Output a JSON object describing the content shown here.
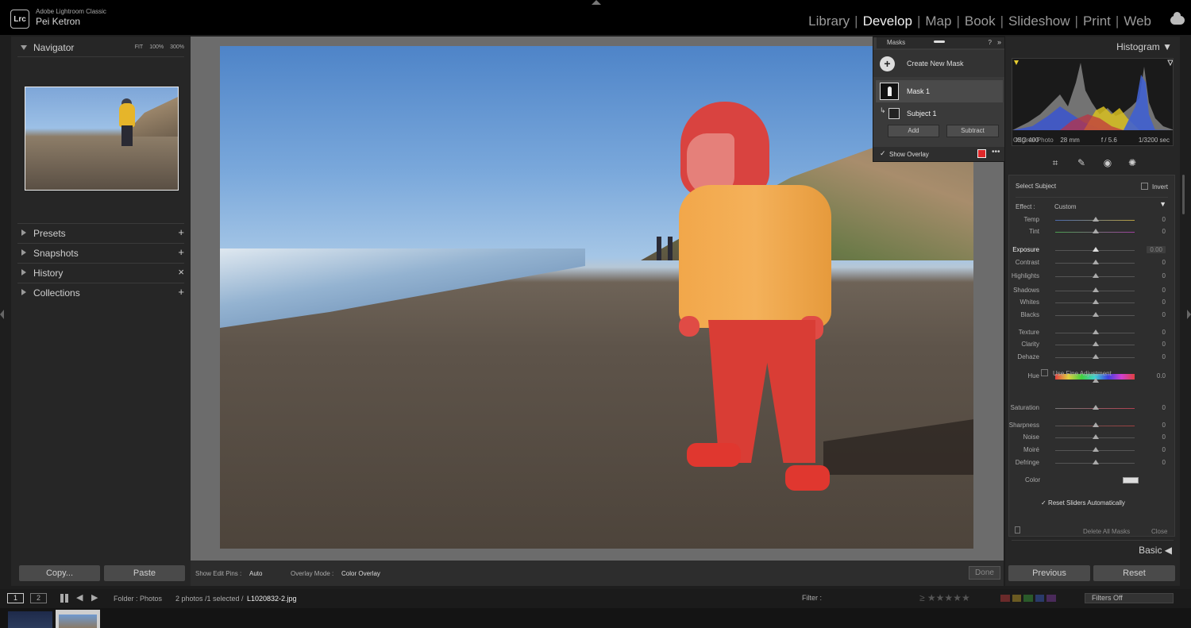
{
  "app": {
    "logo": "Lrc",
    "name": "Adobe Lightroom Classic",
    "user": "Pei Ketron"
  },
  "modules": [
    "Library",
    "Develop",
    "Map",
    "Book",
    "Slideshow",
    "Print",
    "Web"
  ],
  "active_module": "Develop",
  "left_panel": {
    "navigator": {
      "title": "Navigator",
      "zoom_options": [
        "FIT",
        "100%",
        "300%"
      ]
    },
    "sections": [
      {
        "label": "Presets",
        "action": "+"
      },
      {
        "label": "Snapshots",
        "action": "+"
      },
      {
        "label": "History",
        "action": "×"
      },
      {
        "label": "Collections",
        "action": "+"
      }
    ],
    "copy_label": "Copy...",
    "paste_label": "Paste"
  },
  "masks_panel": {
    "title": "Masks",
    "create_new": "Create New Mask",
    "mask_name": "Mask 1",
    "subject_name": "Subject 1",
    "add_label": "Add",
    "subtract_label": "Subtract",
    "show_overlay": "Show Overlay",
    "overlay_color": "#e0282a"
  },
  "toolbar": {
    "show_pins_label": "Show Edit Pins :",
    "show_pins_value": "Auto",
    "overlay_mode_label": "Overlay Mode :",
    "overlay_mode_value": "Color Overlay",
    "done_label": "Done"
  },
  "right_panel": {
    "histogram_title": "Histogram",
    "histogram_info": {
      "iso": "ISO 400",
      "focal": "28 mm",
      "aperture": "f / 5.6",
      "shutter": "1/3200 sec"
    },
    "original_photo": "Original Photo",
    "select_subject": "Select Subject",
    "invert": "Invert",
    "effect_label": "Effect :",
    "effect_value": "Custom",
    "sliders": [
      {
        "label": "Temp",
        "value": "0"
      },
      {
        "label": "Tint",
        "value": "0"
      },
      {
        "label": "Exposure",
        "value": "0.00"
      },
      {
        "label": "Contrast",
        "value": "0"
      },
      {
        "label": "Highlights",
        "value": "0"
      },
      {
        "label": "Shadows",
        "value": "0"
      },
      {
        "label": "Whites",
        "value": "0"
      },
      {
        "label": "Blacks",
        "value": "0"
      },
      {
        "label": "Texture",
        "value": "0"
      },
      {
        "label": "Clarity",
        "value": "0"
      },
      {
        "label": "Dehaze",
        "value": "0"
      },
      {
        "label": "Hue",
        "value": "0.0"
      },
      {
        "label": "Saturation",
        "value": "0"
      },
      {
        "label": "Sharpness",
        "value": "0"
      },
      {
        "label": "Noise",
        "value": "0"
      },
      {
        "label": "Moiré",
        "value": "0"
      },
      {
        "label": "Defringe",
        "value": "0"
      }
    ],
    "fine_adjustment": "Use Fine Adjustment",
    "color_label": "Color",
    "reset_auto": "Reset Sliders Automatically",
    "delete_all": "Delete All Masks",
    "close": "Close",
    "basic_title": "Basic",
    "previous_label": "Previous",
    "reset_label": "Reset"
  },
  "filmstrip": {
    "page1": "1",
    "page2": "2",
    "folder": "Folder : Photos",
    "count": "2 photos /1 selected /",
    "filename": "L1020832-2.jpg",
    "filter_label": "Filter :",
    "filters_value": "Filters Off"
  }
}
